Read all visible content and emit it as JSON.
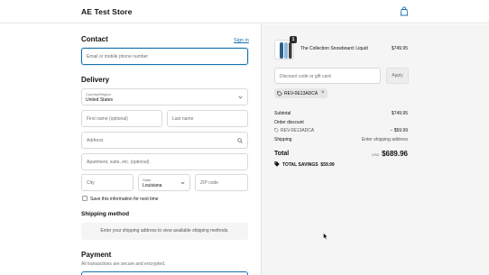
{
  "header": {
    "store_name": "AE Test Store",
    "cart_icon": "bag-icon"
  },
  "contact": {
    "heading": "Contact",
    "sign_in": "Sign in",
    "email_placeholder": "Email or mobile phone number"
  },
  "delivery": {
    "heading": "Delivery",
    "country_label": "Country/Region",
    "country_value": "United States",
    "first_name_placeholder": "First name (optional)",
    "last_name_placeholder": "Last name",
    "address_placeholder": "Address",
    "apartment_placeholder": "Apartment, suite, etc. (optional)",
    "city_placeholder": "City",
    "state_label": "State",
    "state_value": "Louisiana",
    "zip_placeholder": "ZIP code",
    "save_info_label": "Save this information for next time"
  },
  "shipping_method": {
    "heading": "Shipping method",
    "message": "Enter your shipping address to view available shipping methods."
  },
  "payment": {
    "heading": "Payment",
    "subtitle": "All transactions are secure and encrypted."
  },
  "order": {
    "item": {
      "quantity": "1",
      "name": "The Collection Snowboard: Liquid",
      "price": "$749.95"
    },
    "discount_placeholder": "Discount code or gift card",
    "apply_label": "Apply",
    "applied_code": "REV-0E13ADCA",
    "subtotal_label": "Subtotal",
    "subtotal_value": "$749.95",
    "order_discount_label": "Order discount",
    "discount_code": "REV-0E13ADCA",
    "discount_value": "− $59.99",
    "shipping_label": "Shipping",
    "shipping_value": "Enter shipping address",
    "total_label": "Total",
    "currency": "USD",
    "total_value": "$689.96",
    "total_savings_label": "TOTAL SAVINGS",
    "total_savings_value": "$59.99"
  },
  "colors": {
    "accent": "#1773b0",
    "summary_bg": "#f5f5f5",
    "border": "#d9d9d9"
  }
}
